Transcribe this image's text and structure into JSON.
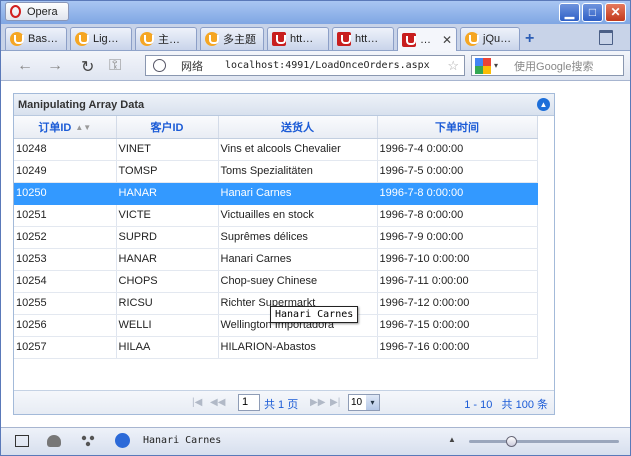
{
  "window": {
    "menu_button": "Opera",
    "min_glyph": "▁",
    "max_glyph": "□",
    "close_glyph": "✕"
  },
  "tabs": [
    {
      "label": "Bas…",
      "icon": "speed-dial-icon",
      "color": "#f5a623"
    },
    {
      "label": "Lig…",
      "icon": "speed-dial-icon",
      "color": "#f5a623"
    },
    {
      "label": "主…",
      "icon": "speed-dial-icon",
      "color": "#f5a623"
    },
    {
      "label": "多主题",
      "icon": "speed-dial-icon",
      "color": "#f5a623"
    },
    {
      "label": "htt…",
      "icon": "page-icon",
      "color": "#c81e1e"
    },
    {
      "label": "htt…",
      "icon": "page-icon",
      "color": "#c81e1e"
    },
    {
      "label": "…",
      "icon": "page-icon",
      "color": "#c81e1e",
      "active": true
    },
    {
      "label": "jQu…",
      "icon": "speed-dial-icon",
      "color": "#f5a623"
    }
  ],
  "new_tab_glyph": "+",
  "tab_close_glyph": "✕",
  "toolbar": {
    "back_glyph": "←",
    "forward_glyph": "→",
    "reload_glyph": "↻",
    "key_glyph": "⚿",
    "network_label": "网络",
    "url": "localhost:4991/LoadOnceOrders.aspx",
    "star_glyph": "☆",
    "search_placeholder": "使用Google搜索",
    "search_dropdown": "▾",
    "search_go": "⟳"
  },
  "grid": {
    "caption": "Manipulating Array Data",
    "collapse_glyph": "▲",
    "columns": [
      "订单ID",
      "客户ID",
      "送货人",
      "下单时间"
    ],
    "sort_glyph": "▲▼",
    "rows": [
      {
        "id": "10248",
        "customer": "VINET",
        "shipper": "Vins et alcools Chevalier",
        "date": "1996-7-4 0:00:00"
      },
      {
        "id": "10249",
        "customer": "TOMSP",
        "shipper": "Toms Spezialitäten",
        "date": "1996-7-5 0:00:00"
      },
      {
        "id": "10250",
        "customer": "HANAR",
        "shipper": "Hanari Carnes",
        "date": "1996-7-8 0:00:00",
        "selected": true
      },
      {
        "id": "10251",
        "customer": "VICTE",
        "shipper": "Victuailles en stock",
        "date": "1996-7-8 0:00:00"
      },
      {
        "id": "10252",
        "customer": "SUPRD",
        "shipper": "Suprêmes délices",
        "date": "1996-7-9 0:00:00"
      },
      {
        "id": "10253",
        "customer": "HANAR",
        "shipper": "Hanari Carnes",
        "date": "1996-7-10 0:00:00"
      },
      {
        "id": "10254",
        "customer": "CHOPS",
        "shipper": "Chop-suey Chinese",
        "date": "1996-7-11 0:00:00"
      },
      {
        "id": "10255",
        "customer": "RICSU",
        "shipper": "Richter Supermarkt",
        "date": "1996-7-12 0:00:00"
      },
      {
        "id": "10256",
        "customer": "WELLI",
        "shipper": "Wellington Importadora",
        "date": "1996-7-15 0:00:00"
      },
      {
        "id": "10257",
        "customer": "HILAA",
        "shipper": "HILARION-Abastos",
        "date": "1996-7-16 0:00:00"
      }
    ],
    "tooltip": "Hanari Carnes",
    "pager": {
      "first_glyph": "|◀",
      "prev_glyph": "◀◀",
      "next_glyph": "▶▶",
      "last_glyph": "▶|",
      "page": "1",
      "total_pages": "共 1 页",
      "page_size": "10",
      "page_size_dropdown": "▾",
      "view_range": "1 - 10",
      "view_total": "共 100 条"
    }
  },
  "statusbar": {
    "text": "Hanari Carnes",
    "zoom_caret": "▲",
    "zoom_level": 0.28
  }
}
